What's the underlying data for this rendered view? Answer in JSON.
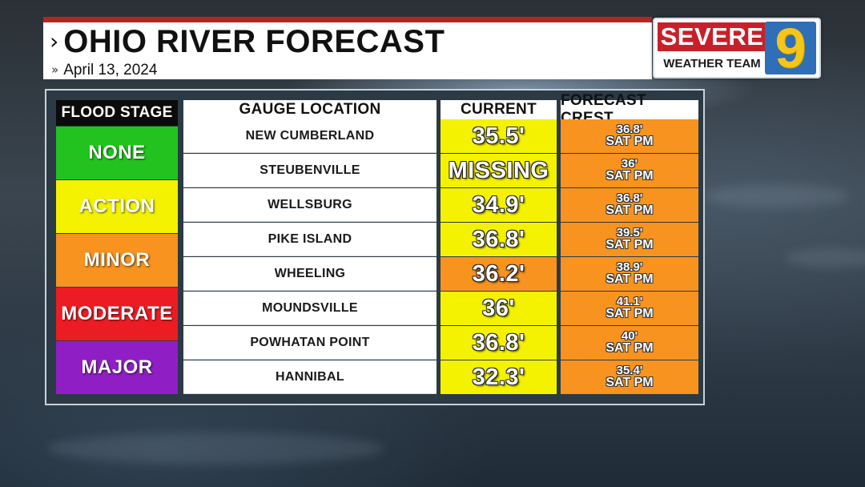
{
  "header": {
    "title": "OHIO RIVER FORECAST",
    "title_icon": "chevron-right-icon",
    "date": "April 13, 2024",
    "date_icon": "double-chevron-right-icon"
  },
  "logo": {
    "line1": "SEVERE",
    "line2": "WEATHER TEAM",
    "number": "9",
    "colors": {
      "severe_bg": "#c8202a",
      "nine_bg": "#2f6fb8",
      "nine_fg": "#f5c518"
    }
  },
  "table": {
    "headers": {
      "flood_stage": "FLOOD STAGE",
      "location": "GAUGE LOCATION",
      "current": "CURRENT",
      "forecast": "FORECAST CREST"
    },
    "flood_stages": [
      {
        "label": "NONE",
        "color": "#22c31f"
      },
      {
        "label": "ACTION",
        "color": "#f4f200"
      },
      {
        "label": "MINOR",
        "color": "#f7931e"
      },
      {
        "label": "MODERATE",
        "color": "#ec1c24"
      },
      {
        "label": "MAJOR",
        "color": "#8f1fc4"
      }
    ],
    "stage_colors": {
      "action": "#f4f200",
      "minor": "#f7931e"
    },
    "rows": [
      {
        "location": "NEW CUMBERLAND",
        "current": "35.5'",
        "current_stage": "action",
        "crest": "36.8'",
        "crest_time": "SAT PM"
      },
      {
        "location": "STEUBENVILLE",
        "current": "MISSING",
        "current_stage": "action",
        "crest": "36'",
        "crest_time": "SAT PM"
      },
      {
        "location": "WELLSBURG",
        "current": "34.9'",
        "current_stage": "action",
        "crest": "36.8'",
        "crest_time": "SAT PM"
      },
      {
        "location": "PIKE ISLAND",
        "current": "36.8'",
        "current_stage": "action",
        "crest": "39.5'",
        "crest_time": "SAT PM"
      },
      {
        "location": "WHEELING",
        "current": "36.2'",
        "current_stage": "minor",
        "crest": "38.9'",
        "crest_time": "SAT PM"
      },
      {
        "location": "MOUNDSVILLE",
        "current": "36'",
        "current_stage": "action",
        "crest": "41.1'",
        "crest_time": "SAT PM"
      },
      {
        "location": "POWHATAN POINT",
        "current": "36.8'",
        "current_stage": "action",
        "crest": "40'",
        "crest_time": "SAT PM"
      },
      {
        "location": "HANNIBAL",
        "current": "32.3'",
        "current_stage": "action",
        "crest": "35.4'",
        "crest_time": "SAT PM"
      }
    ]
  }
}
